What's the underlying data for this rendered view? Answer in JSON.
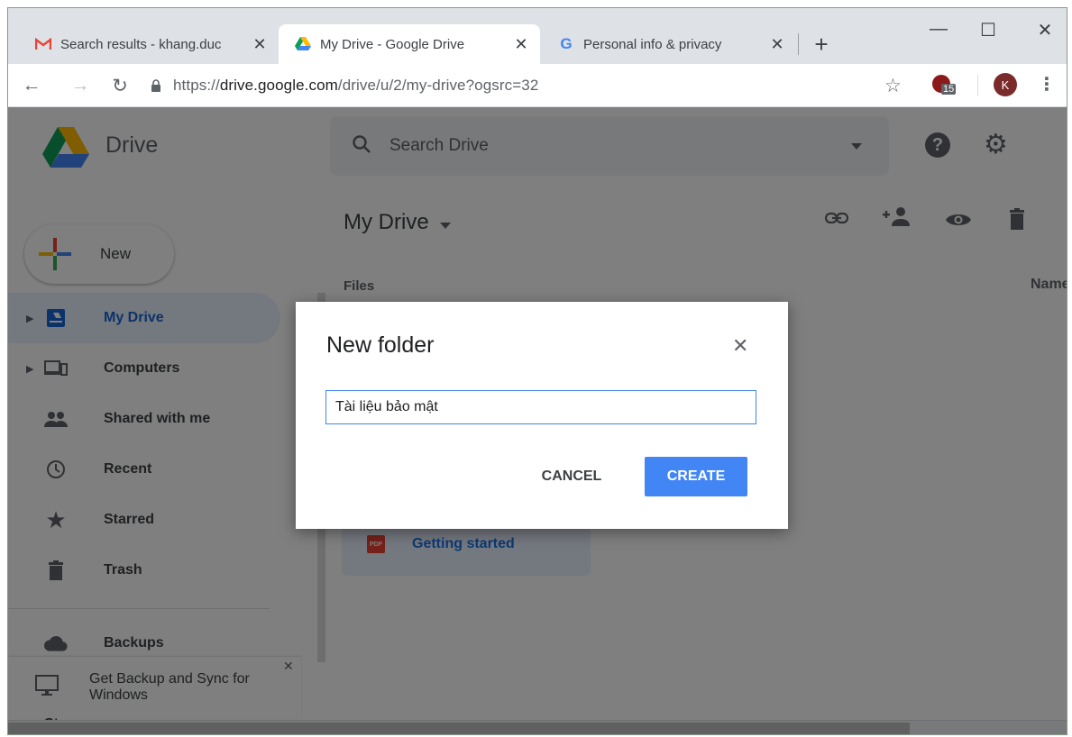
{
  "browser": {
    "tabs": [
      {
        "title": "Search results - khang.duc",
        "favicon": "gmail-icon"
      },
      {
        "title": "My Drive - Google Drive",
        "favicon": "drive-icon"
      },
      {
        "title": "Personal info & privacy",
        "favicon": "google-icon"
      }
    ],
    "url_prefix": "https://",
    "url_host": "drive.google.com",
    "url_path": "/drive/u/2/my-drive?ogsrc=32",
    "extension_badge": "15",
    "profile_initial": "K"
  },
  "drive": {
    "app_name": "Drive",
    "search_placeholder": "Search Drive",
    "new_label": "New",
    "nav": [
      {
        "label": "My Drive",
        "icon": "my-drive-icon",
        "active": true
      },
      {
        "label": "Computers",
        "icon": "computers-icon"
      },
      {
        "label": "Shared with me",
        "icon": "shared-icon"
      },
      {
        "label": "Recent",
        "icon": "clock-icon"
      },
      {
        "label": "Starred",
        "icon": "star-icon"
      },
      {
        "label": "Trash",
        "icon": "trash-icon"
      }
    ],
    "backups_label": "Backups",
    "storage_label": "Storage",
    "promo_text": "Get Backup and Sync for Windows",
    "main_title": "My Drive",
    "files_label": "Files",
    "name_header": "Name",
    "file_name": "Getting started",
    "file_type": "PDF"
  },
  "dialog": {
    "title": "New folder",
    "input_value": "Tài liệu bảo mật",
    "cancel_label": "CANCEL",
    "create_label": "CREATE"
  },
  "colors": {
    "accent": "#4285f4",
    "active_nav": "#1967d2",
    "scrim": "rgba(0,0,0,0.5)"
  }
}
